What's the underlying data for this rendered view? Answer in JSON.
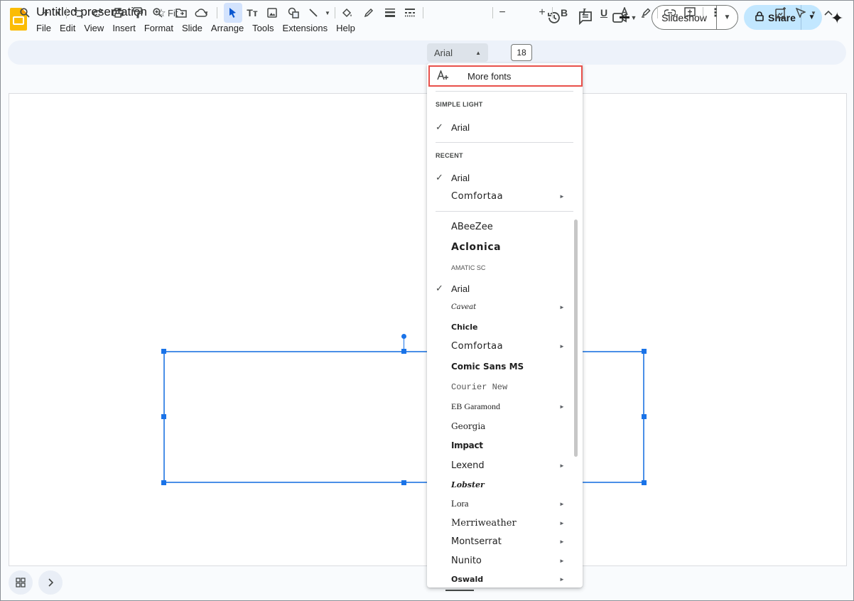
{
  "app": {
    "title": "Untitled presentation",
    "menus": [
      "File",
      "Edit",
      "View",
      "Insert",
      "Format",
      "Slide",
      "Arrange",
      "Tools",
      "Extensions",
      "Help"
    ]
  },
  "header": {
    "slideshow_label": "Slideshow",
    "share_label": "Share"
  },
  "toolbar": {
    "zoom_label": "Fit",
    "font_name": "Arial",
    "font_size": "18"
  },
  "font_menu": {
    "more_fonts": "More fonts",
    "section_theme": "SIMPLE LIGHT",
    "section_recent": "RECENT",
    "check_glyph": "✓",
    "arrow_glyph": "►",
    "theme_fonts": [
      {
        "name": "Arial",
        "checked": true,
        "submenu": false
      }
    ],
    "recent_fonts": [
      {
        "name": "Arial",
        "checked": true,
        "submenu": false
      },
      {
        "name": "Comfortaa",
        "checked": false,
        "submenu": true
      }
    ],
    "all_fonts": [
      {
        "name": "ABeeZee",
        "checked": false,
        "submenu": false
      },
      {
        "name": "Aclonica",
        "checked": false,
        "submenu": false
      },
      {
        "name": "Amatic SC",
        "checked": false,
        "submenu": false
      },
      {
        "name": "Arial",
        "checked": true,
        "submenu": false
      },
      {
        "name": "Caveat",
        "checked": false,
        "submenu": true
      },
      {
        "name": "Chicle",
        "checked": false,
        "submenu": false
      },
      {
        "name": "Comfortaa",
        "checked": false,
        "submenu": true
      },
      {
        "name": "Comic Sans MS",
        "checked": false,
        "submenu": false
      },
      {
        "name": "Courier New",
        "checked": false,
        "submenu": false
      },
      {
        "name": "EB Garamond",
        "checked": false,
        "submenu": true
      },
      {
        "name": "Georgia",
        "checked": false,
        "submenu": false
      },
      {
        "name": "Impact",
        "checked": false,
        "submenu": false
      },
      {
        "name": "Lexend",
        "checked": false,
        "submenu": true
      },
      {
        "name": "Lobster",
        "checked": false,
        "submenu": false
      },
      {
        "name": "Lora",
        "checked": false,
        "submenu": true
      },
      {
        "name": "Merriweather",
        "checked": false,
        "submenu": true
      },
      {
        "name": "Montserrat",
        "checked": false,
        "submenu": true
      },
      {
        "name": "Nunito",
        "checked": false,
        "submenu": true
      },
      {
        "name": "Oswald",
        "checked": false,
        "submenu": true
      }
    ]
  },
  "colors": {
    "accent": "#1a73e8",
    "highlight_border": "#e8504a",
    "share_bg": "#c2e7ff"
  }
}
